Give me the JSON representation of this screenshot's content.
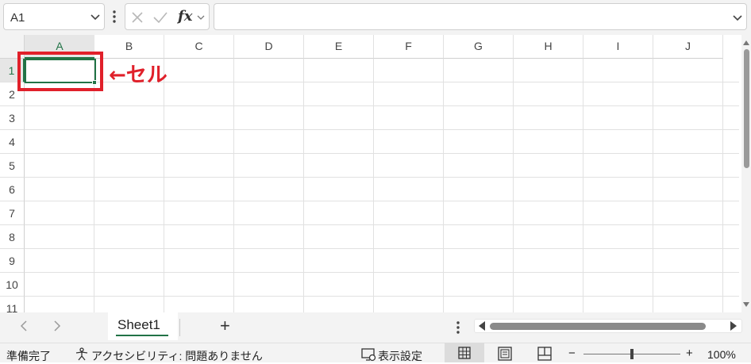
{
  "name_box": {
    "value": "A1"
  },
  "formula_bar": {
    "fx_label": "fx",
    "formula_value": ""
  },
  "columns": [
    "A",
    "B",
    "C",
    "D",
    "E",
    "F",
    "G",
    "H",
    "I",
    "J"
  ],
  "rows": [
    "1",
    "2",
    "3",
    "4",
    "5",
    "6",
    "7",
    "8",
    "9",
    "10",
    "11"
  ],
  "selected_cell": "A1",
  "annotation": {
    "text": "←セル",
    "color": "#e0202a"
  },
  "sheets": [
    {
      "name": "Sheet1",
      "active": true
    }
  ],
  "add_sheet_label": "+",
  "status_bar": {
    "ready": "準備完了",
    "accessibility": "アクセシビリティ: 問題ありません",
    "display_settings": "表示設定",
    "zoom_out": "−",
    "zoom_in": "+",
    "zoom": "100%",
    "zoom_level_percent": 100
  },
  "colors": {
    "accent": "#217346",
    "highlight": "#e0202a"
  }
}
